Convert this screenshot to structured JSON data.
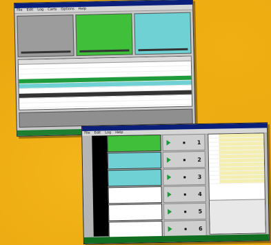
{
  "window1": {
    "title": "",
    "menu": [
      "File",
      "Edit",
      "Log",
      "Carts",
      "Options",
      "Help"
    ],
    "panels": [
      {
        "color": "#9c9c9c"
      },
      {
        "color": "#3fbf3a"
      },
      {
        "color": "#6fd1d3"
      }
    ]
  },
  "window2": {
    "menu": [
      "File",
      "Edit",
      "Log",
      "Help"
    ],
    "cart_numbers": [
      "1",
      "2",
      "3",
      "4",
      "5",
      "6"
    ]
  }
}
